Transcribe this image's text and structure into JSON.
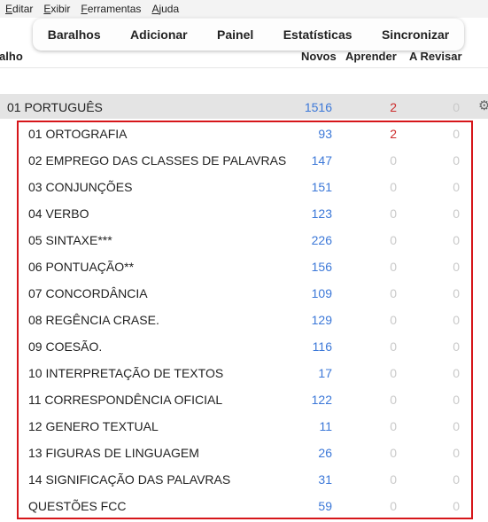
{
  "menu": [
    "Editar",
    "Exibir",
    "Ferramentas",
    "Ajuda"
  ],
  "toolbar": [
    "Baralhos",
    "Adicionar",
    "Painel",
    "Estatísticas",
    "Sincronizar"
  ],
  "columns": {
    "name": "ralho",
    "new": "Novos",
    "learn": "Aprender",
    "review": "A Revisar"
  },
  "parent": {
    "name": "01 PORTUGUÊS",
    "new": "1516",
    "learn": "2",
    "review": "0"
  },
  "decks": [
    {
      "name": "01 ORTOGRAFIA",
      "new": "93",
      "learn": "2",
      "review": "0"
    },
    {
      "name": "02 EMPREGO DAS CLASSES DE PALAVRAS",
      "new": "147",
      "learn": "0",
      "review": "0"
    },
    {
      "name": "03 CONJUNÇÕES",
      "new": "151",
      "learn": "0",
      "review": "0"
    },
    {
      "name": "04 VERBO",
      "new": "123",
      "learn": "0",
      "review": "0"
    },
    {
      "name": "05 SINTAXE***",
      "new": "226",
      "learn": "0",
      "review": "0"
    },
    {
      "name": "06 PONTUAÇÃO**",
      "new": "156",
      "learn": "0",
      "review": "0"
    },
    {
      "name": "07 CONCORDÂNCIA",
      "new": "109",
      "learn": "0",
      "review": "0"
    },
    {
      "name": "08 REGÊNCIA CRASE.",
      "new": "129",
      "learn": "0",
      "review": "0"
    },
    {
      "name": "09 COESÃO.",
      "new": "116",
      "learn": "0",
      "review": "0"
    },
    {
      "name": "10 INTERPRETAÇÃO DE TEXTOS",
      "new": "17",
      "learn": "0",
      "review": "0"
    },
    {
      "name": "11 CORRESPONDÊNCIA OFICIAL",
      "new": "122",
      "learn": "0",
      "review": "0"
    },
    {
      "name": "12 GENERO TEXTUAL",
      "new": "11",
      "learn": "0",
      "review": "0"
    },
    {
      "name": "13 FIGURAS DE LINGUAGEM",
      "new": "26",
      "learn": "0",
      "review": "0"
    },
    {
      "name": "14 SIGNIFICAÇÃO DAS PALAVRAS",
      "new": "31",
      "learn": "0",
      "review": "0"
    },
    {
      "name": "QUESTÕES FCC",
      "new": "59",
      "learn": "0",
      "review": "0"
    }
  ],
  "colors": {
    "new": "#3c78d8",
    "learn": "#cc2b2b",
    "zero": "#c9c9c9",
    "highlight_box": "#d6161a"
  },
  "icons": {
    "gear": "gear-icon"
  }
}
